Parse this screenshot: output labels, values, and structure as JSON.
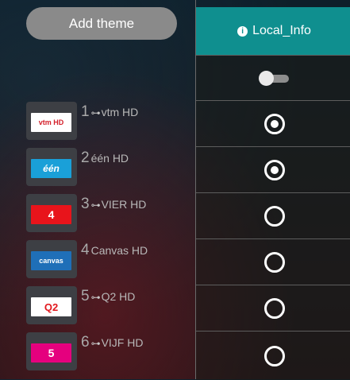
{
  "add_theme_label": "Add theme",
  "column": {
    "title": "Local_Info",
    "info_icon_glyph": "i",
    "toggle_on": false
  },
  "channels": [
    {
      "number": "1",
      "locked": true,
      "name": "vtm HD",
      "logo_text": "vtm HD",
      "logo_bg": "#ffffff",
      "logo_fg": "#d4202a",
      "selected": true
    },
    {
      "number": "2",
      "locked": false,
      "name": "één HD",
      "logo_text": "één",
      "logo_bg": "#1aa0d8",
      "logo_fg": "#ffffff",
      "selected": true
    },
    {
      "number": "3",
      "locked": true,
      "name": "VIER HD",
      "logo_text": "4",
      "logo_bg": "#e8141b",
      "logo_fg": "#ffffff",
      "selected": false
    },
    {
      "number": "4",
      "locked": false,
      "name": "Canvas HD",
      "logo_text": "canvas",
      "logo_bg": "#1f6fb8",
      "logo_fg": "#ffffff",
      "selected": false
    },
    {
      "number": "5",
      "locked": true,
      "name": "Q2 HD",
      "logo_text": "Q2",
      "logo_bg": "#ffffff",
      "logo_fg": "#e2171d",
      "selected": false
    },
    {
      "number": "6",
      "locked": true,
      "name": "VIJF HD",
      "logo_text": "5",
      "logo_bg": "#e5007e",
      "logo_fg": "#ffffff",
      "selected": false
    }
  ],
  "icons": {
    "key": "key-icon",
    "info": "info-icon",
    "radio_on": "radio-checked-icon",
    "radio_off": "radio-unchecked-icon"
  }
}
